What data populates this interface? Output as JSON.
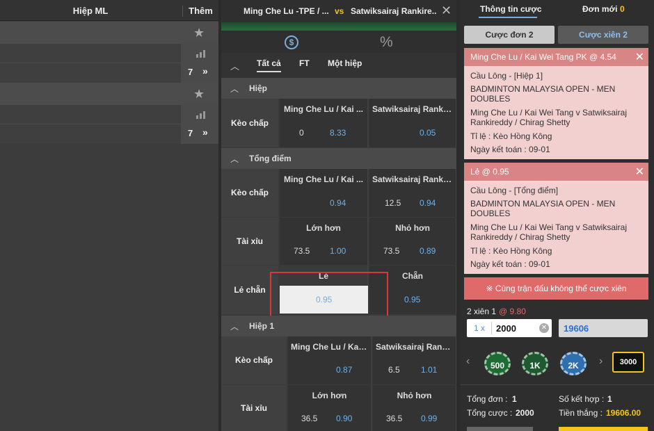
{
  "left": {
    "header_col1": "Hiệp ML",
    "header_col2": "Thêm",
    "rows": [
      {
        "count": "7",
        "more": "»"
      },
      {
        "count": "7",
        "more": "»"
      }
    ]
  },
  "match": {
    "home": "Ming Che Lu -TPE / ...",
    "vs": "vs",
    "away": "Satwiksairaj Rankire...",
    "close": "✕"
  },
  "icons": {
    "coin": "$",
    "percent": "%"
  },
  "tabs": [
    "Tất cả",
    "FT",
    "Một hiệp"
  ],
  "sections": {
    "hiep": {
      "title": "Hiệp",
      "row_label": "Kèo chấp",
      "col1": "Ming Che Lu / Kai ...",
      "col2": "Satwiksairaj Rankir...",
      "h1": "0",
      "o1": "8.33",
      "h2": "",
      "o2": "0.05"
    },
    "tong": {
      "title": "Tổng điểm",
      "keo_label": "Kèo chấp",
      "col1": "Ming Che Lu / Kai ...",
      "col2": "Satwiksairaj Rankir...",
      "k_h1": "",
      "k_o1": "0.94",
      "k_h2": "12.5",
      "k_o2": "0.94",
      "taixiu_label": "Tài xỉu",
      "over": "Lớn hơn",
      "under": "Nhỏ hơn",
      "t_h1": "73.5",
      "t_o1": "1.00",
      "t_h2": "73.5",
      "t_o2": "0.89",
      "lechan_label": "Lẻ chẵn",
      "le": "Lẻ",
      "chan": "Chẵn",
      "le_odd": "0.95",
      "chan_odd": "0.95"
    },
    "hiep1": {
      "title": "Hiệp 1",
      "keo_label": "Kèo chấp",
      "col1": "Ming Che Lu / Kai ...",
      "col2": "Satwiksairaj Rankir...",
      "k_h1": "",
      "k_o1": "0.87",
      "k_h2": "6.5",
      "k_o2": "1.01",
      "taixiu_label": "Tài xỉu",
      "over": "Lớn hơn",
      "under": "Nhỏ hơn",
      "t_h1": "36.5",
      "t_o1": "0.90",
      "t_h2": "36.5",
      "t_o2": "0.99"
    }
  },
  "betslip": {
    "tab_info": "Thông tin cược",
    "tab_new": "Đơn mới",
    "new_count": "0",
    "single": "Cược đơn 2",
    "parlay": "Cược xiên 2",
    "cards": [
      {
        "header": "Ming Che Lu / Kai Wei Tang PK @ 4.54",
        "sport": "Cầu Lông - [Hiệp 1]",
        "league1": "BADMINTON MALAYSIA OPEN - MEN",
        "league2": "DOUBLES",
        "match1": "Ming Che Lu / Kai Wei Tang v Satwiksairaj",
        "match2": "Rankireddy / Chirag Shetty",
        "odds_type": "Tỉ lệ : Kèo Hồng Kông",
        "settle": "Ngày kết toán : 09-01"
      },
      {
        "header": "Lẻ @ 0.95",
        "sport": "Cầu Lông - [Tổng điểm]",
        "league1": "BADMINTON MALAYSIA OPEN - MEN",
        "league2": "DOUBLES",
        "match1": "Ming Che Lu / Kai Wei Tang v Satwiksairaj",
        "match2": "Rankireddy / Chirag Shetty",
        "odds_type": "Tỉ lệ : Kèo Hồng Kông",
        "settle": "Ngày kết toán : 09-01"
      }
    ],
    "warning": "※ Cùng trận đấu không thể cược xiên",
    "parlay_label": "2 xiên 1",
    "parlay_odds": "@ 9.80",
    "multiplier": "1 x",
    "stake": "2000",
    "payout": "19606",
    "chips": [
      "500",
      "1K",
      "2K",
      "3000"
    ],
    "total_label": "Tổng đơn :",
    "total": "1",
    "combo_label": "Số kết hợp :",
    "combo": "1",
    "stake_label": "Tổng cược :",
    "stake_total": "2000",
    "win_label": "Tiền thắng :",
    "win": "19606.00"
  },
  "colors": {
    "odds": "#6fb0e8",
    "card_header": "#d98585",
    "card_body": "#f2d0d0",
    "warning": "#e06a6a",
    "highlight": "#f5c518"
  }
}
